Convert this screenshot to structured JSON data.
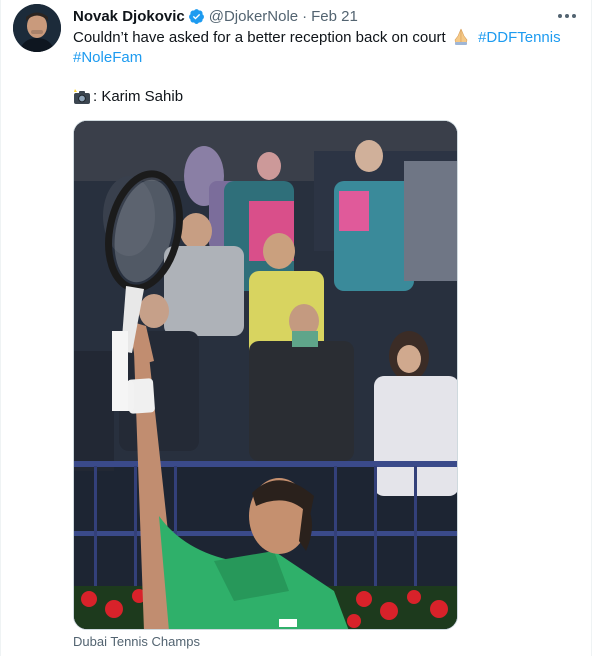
{
  "tweet": {
    "author_name": "Novak Djokovic",
    "handle": "@DjokerNole",
    "separator": "·",
    "date": "Feb 21",
    "text_main": "Couldn’t have asked for a better reception back on court",
    "hashtag_1": "#DDFTennis",
    "hashtag_2": "#NoleFam",
    "credit_text": ": Karim Sahib",
    "media_source": "Dubai Tennis Champs"
  },
  "icons": {
    "verified": "verified-badge-icon",
    "more": "more-options-icon",
    "pray": "folded-hands-emoji",
    "camera": "camera-flash-emoji"
  },
  "colors": {
    "hashtag": "#1d9bf0",
    "verified": "#1d9bf0",
    "secondary_text": "#536471",
    "shirt": "#2fb06a"
  }
}
